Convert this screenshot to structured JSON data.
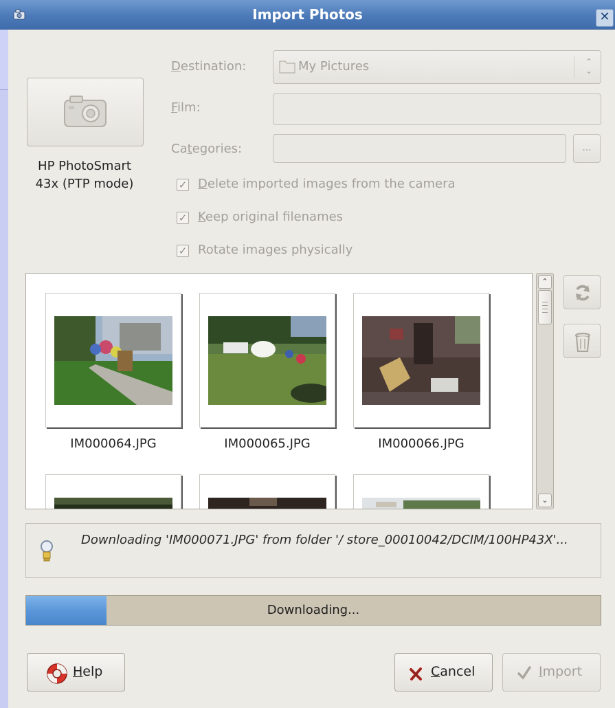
{
  "window": {
    "title": "Import Photos",
    "close_glyph": "✕"
  },
  "camera": {
    "icon": "camera-icon",
    "name": "HP PhotoSmart 43x (PTP mode)"
  },
  "form": {
    "destination_label_mnemonic": "D",
    "destination_label_rest": "estination:",
    "destination_value": "My Pictures",
    "destination_icon": "folder-icon",
    "film_label_mnemonic": "F",
    "film_label_rest": "ilm:",
    "film_value": "",
    "categories_label_pre": "Ca",
    "categories_label_mnemonic": "t",
    "categories_label_rest": "egories:",
    "categories_value": "",
    "categories_button_label": "...",
    "options": [
      {
        "mnemonic": "D",
        "rest": "elete imported images from the camera",
        "checked": true
      },
      {
        "mnemonic": "K",
        "rest": "eep original filenames",
        "checked": true
      },
      {
        "mnemonic": "",
        "rest": "Rotate images physically",
        "checked": true
      }
    ]
  },
  "thumbnails": [
    {
      "filename": "IM000064.JPG"
    },
    {
      "filename": "IM000065.JPG"
    },
    {
      "filename": "IM000066.JPG"
    }
  ],
  "side_buttons": {
    "refresh_icon": "refresh-icon",
    "trash_icon": "trash-icon"
  },
  "status": {
    "icon": "lightbulb-icon",
    "message": "Downloading 'IM000071.JPG' from folder '/ store_00010042/DCIM/100HP43X'..."
  },
  "progress": {
    "fraction": 0.14,
    "text": "Downloading..."
  },
  "buttons": {
    "help_mnemonic": "H",
    "help_rest": "elp",
    "help_icon": "lifebuoy-icon",
    "cancel_mnemonic": "C",
    "cancel_rest": "ancel",
    "cancel_icon": "cancel-x-icon",
    "import_mnemonic": "I",
    "import_rest": "mport",
    "import_icon": "checkmark-icon"
  },
  "colors": {
    "titlebar": "#4c7ab8",
    "progress_fill": "#5b97d9",
    "progress_track": "#cdc5b4"
  }
}
